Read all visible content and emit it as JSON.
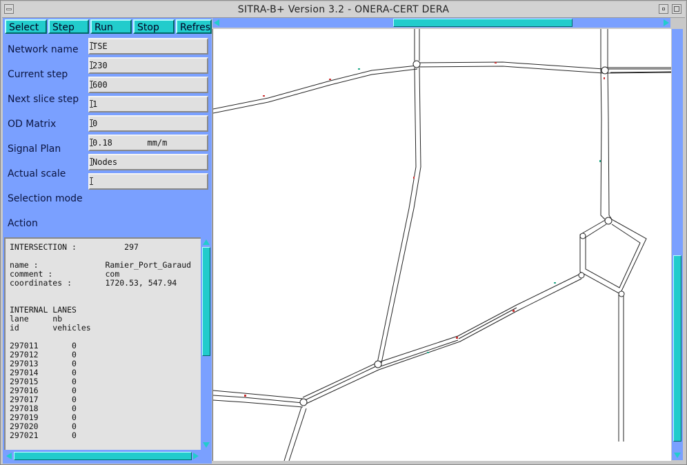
{
  "window": {
    "title": "SITRA-B+ Version 3.2 - ONERA-CERT DERA"
  },
  "toolbar": {
    "buttons": [
      "Select",
      "Step",
      "Run",
      "Stop",
      "Refresh"
    ]
  },
  "form": {
    "labels": [
      "Network name",
      "Current step",
      "Next slice step",
      "OD Matrix",
      "Signal Plan",
      "Actual scale",
      "Selection mode",
      "Action"
    ],
    "fields": [
      "TSE",
      "230",
      "600",
      "1",
      "0",
      "0.18       mm/m",
      "Nodes",
      ""
    ]
  },
  "info": {
    "lines": [
      "INTERSECTION :          297",
      "",
      "name :              Ramier_Port_Garaud",
      "comment :           com",
      "coordinates :       1720.53, 547.94",
      "",
      "",
      "INTERNAL LANES",
      "lane     nb",
      "id       vehicles",
      "",
      "297011       0",
      "297012       0",
      "297013       0",
      "297014       0",
      "297015       0",
      "297016       0",
      "297017       0",
      "297018       0",
      "297019       0",
      "297020       0",
      "297021       0"
    ]
  },
  "scroll": {
    "info_vertical_position": 0.0,
    "map_horizontal_position": 0.5,
    "map_vertical_position": 0.55
  },
  "colors": {
    "panel": "#7aa0ff",
    "button": "#22cccc",
    "map_background": "#ffffff"
  }
}
